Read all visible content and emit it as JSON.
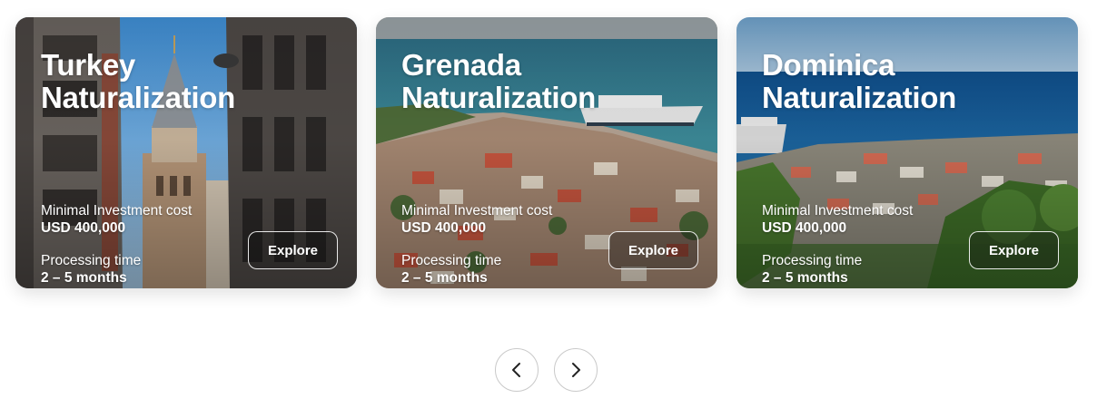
{
  "cards": [
    {
      "title_line1": "Turkey",
      "title_line2": "Naturalization",
      "cost_label": "Minimal Investment cost",
      "cost_value": "USD 400,000",
      "time_label": "Processing time",
      "time_value": "2 – 5 months",
      "button_label": "Explore"
    },
    {
      "title_line1": "Grenada",
      "title_line2": "Naturalization",
      "cost_label": "Minimal Investment cost",
      "cost_value": "USD 400,000",
      "time_label": "Processing time",
      "time_value": "2 – 5 months",
      "button_label": "Explore"
    },
    {
      "title_line1": "Dominica",
      "title_line2": "Naturalization",
      "cost_label": "Minimal Investment cost",
      "cost_value": "USD 400,000",
      "time_label": "Processing time",
      "time_value": "2 – 5 months",
      "button_label": "Explore"
    }
  ],
  "carousel": {
    "prev_icon": "chevron-left-icon",
    "next_icon": "chevron-right-icon"
  },
  "colors": {
    "text_on_image": "#ffffff",
    "nav_border": "#c9c9c9",
    "nav_arrow": "#222222"
  }
}
